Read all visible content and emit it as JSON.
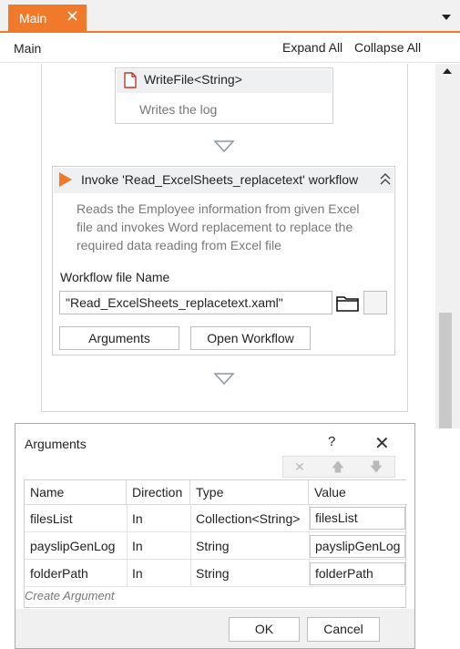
{
  "tab": {
    "label": "Main",
    "close": "✕"
  },
  "breadcrumb": "Main",
  "toolbar": {
    "expand_all": "Expand All",
    "collapse_all": "Collapse All"
  },
  "writefile": {
    "title": "WriteFile<String>",
    "annotation": "Writes the log"
  },
  "invoke": {
    "title": "Invoke 'Read_ExcelSheets_replacetext' workflow",
    "annotation_lines": [
      "Reads the Employee information from given Excel",
      "file and invokes Word replacement to replace the",
      "required data reading from Excel file"
    ],
    "file_label": "Workflow file Name",
    "file_value": "\"Read_ExcelSheets_replacetext.xaml\"",
    "arguments_button": "Arguments",
    "open_workflow_button": "Open Workflow"
  },
  "dialog": {
    "title": "Arguments",
    "help": "?",
    "close": "✕",
    "toolbar": {
      "delete": "✕",
      "up": "🡅",
      "down": "🡇"
    },
    "columns": [
      "Name",
      "Direction",
      "Type",
      "Value"
    ],
    "rows": [
      {
        "name": "filesList",
        "direction": "In",
        "type": "Collection<String>",
        "value": "filesList"
      },
      {
        "name": "payslipGenLog",
        "direction": "In",
        "type": "String",
        "value": "payslipGenLog"
      },
      {
        "name": "folderPath",
        "direction": "In",
        "type": "String",
        "value": "folderPath"
      }
    ],
    "create_argument": "Create Argument",
    "ok": "OK",
    "cancel": "Cancel"
  },
  "colors": {
    "accent": "#f07a2a",
    "header_bg": "#eef0f1",
    "muted_text": "#777777"
  }
}
